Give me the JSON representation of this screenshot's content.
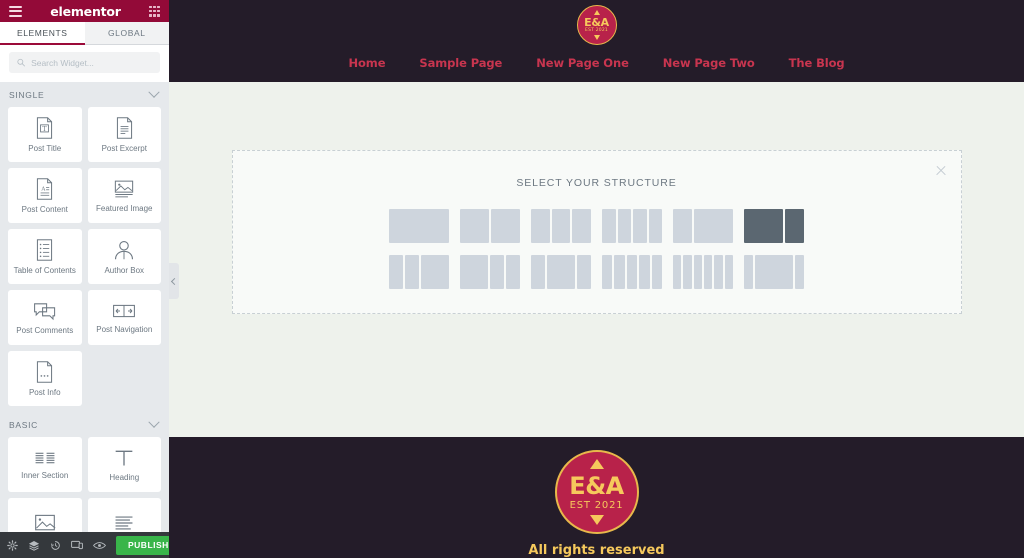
{
  "panel": {
    "header": {
      "brand": "elementor",
      "menu_icon": "hamburger-icon",
      "apps_icon": "grid-apps-icon"
    },
    "tabs": [
      {
        "label": "ELEMENTS",
        "active": true
      },
      {
        "label": "GLOBAL",
        "active": false
      }
    ],
    "search": {
      "placeholder": "Search Widget...",
      "value": "",
      "icon": "search-icon"
    },
    "sections": [
      {
        "title": "SINGLE",
        "collapse_icon": "chevron-down-icon",
        "widgets": [
          {
            "label": "Post Title",
            "icon": "post-title-icon"
          },
          {
            "label": "Post Excerpt",
            "icon": "post-excerpt-icon"
          },
          {
            "label": "Post Content",
            "icon": "post-content-icon"
          },
          {
            "label": "Featured Image",
            "icon": "featured-image-icon"
          },
          {
            "label": "Table of Contents",
            "icon": "table-of-contents-icon"
          },
          {
            "label": "Author Box",
            "icon": "author-box-icon"
          },
          {
            "label": "Post Comments",
            "icon": "post-comments-icon"
          },
          {
            "label": "Post Navigation",
            "icon": "post-navigation-icon"
          },
          {
            "label": "Post Info",
            "icon": "post-info-icon"
          }
        ]
      },
      {
        "title": "BASIC",
        "collapse_icon": "chevron-down-icon",
        "widgets": [
          {
            "label": "Inner Section",
            "icon": "inner-section-icon"
          },
          {
            "label": "Heading",
            "icon": "heading-icon"
          },
          {
            "label": "",
            "icon": "image-icon"
          },
          {
            "label": "",
            "icon": "text-editor-icon"
          }
        ]
      }
    ],
    "footer": {
      "icons": [
        "settings-gear-icon",
        "navigator-layers-icon",
        "history-clock-icon",
        "responsive-mode-icon",
        "preview-eye-icon"
      ],
      "publish_label": "PUBLISH",
      "publish_caret_icon": "caret-up-icon",
      "publish_color": "#39b54a"
    },
    "collapse_handle_icon": "chevron-left-icon"
  },
  "preview": {
    "header": {
      "logo": {
        "initials": "E&A",
        "established": "EST 2021",
        "icon": "ea-badge-logo"
      },
      "nav": [
        {
          "label": "Home"
        },
        {
          "label": "Sample Page"
        },
        {
          "label": "New Page One"
        },
        {
          "label": "New Page Two"
        },
        {
          "label": "The Blog"
        }
      ],
      "background": "#241c29",
      "link_color": "#c8354f"
    },
    "structure_picker": {
      "title": "SELECT YOUR STRUCTURE",
      "close_icon": "close-x-icon",
      "rows": [
        {
          "options": [
            {
              "columns": [
                100
              ],
              "selected": false
            },
            {
              "columns": [
                50,
                50
              ],
              "selected": false
            },
            {
              "columns": [
                33,
                33,
                33
              ],
              "selected": false
            },
            {
              "columns": [
                25,
                25,
                25,
                25
              ],
              "selected": false
            },
            {
              "columns": [
                33,
                67
              ],
              "selected": false
            },
            {
              "columns": [
                67,
                33
              ],
              "selected": true
            }
          ]
        },
        {
          "options": [
            {
              "columns": [
                25,
                25,
                50
              ],
              "selected": false
            },
            {
              "columns": [
                50,
                25,
                25
              ],
              "selected": false
            },
            {
              "columns": [
                25,
                50,
                25
              ],
              "selected": false
            },
            {
              "columns": [
                20,
                20,
                20,
                20,
                20
              ],
              "selected": false
            },
            {
              "columns": [
                16,
                16,
                16,
                16,
                16,
                16
              ],
              "selected": false
            },
            {
              "columns": [
                16,
                68,
                16
              ],
              "selected": false
            }
          ]
        }
      ]
    },
    "footer": {
      "logo": {
        "initials": "E&A",
        "established": "EST 2021",
        "icon": "ea-badge-logo"
      },
      "text": "All rights reserved",
      "background": "#241c29",
      "accent": "#f6c95c"
    },
    "canvas_background": "#eef2ec"
  }
}
